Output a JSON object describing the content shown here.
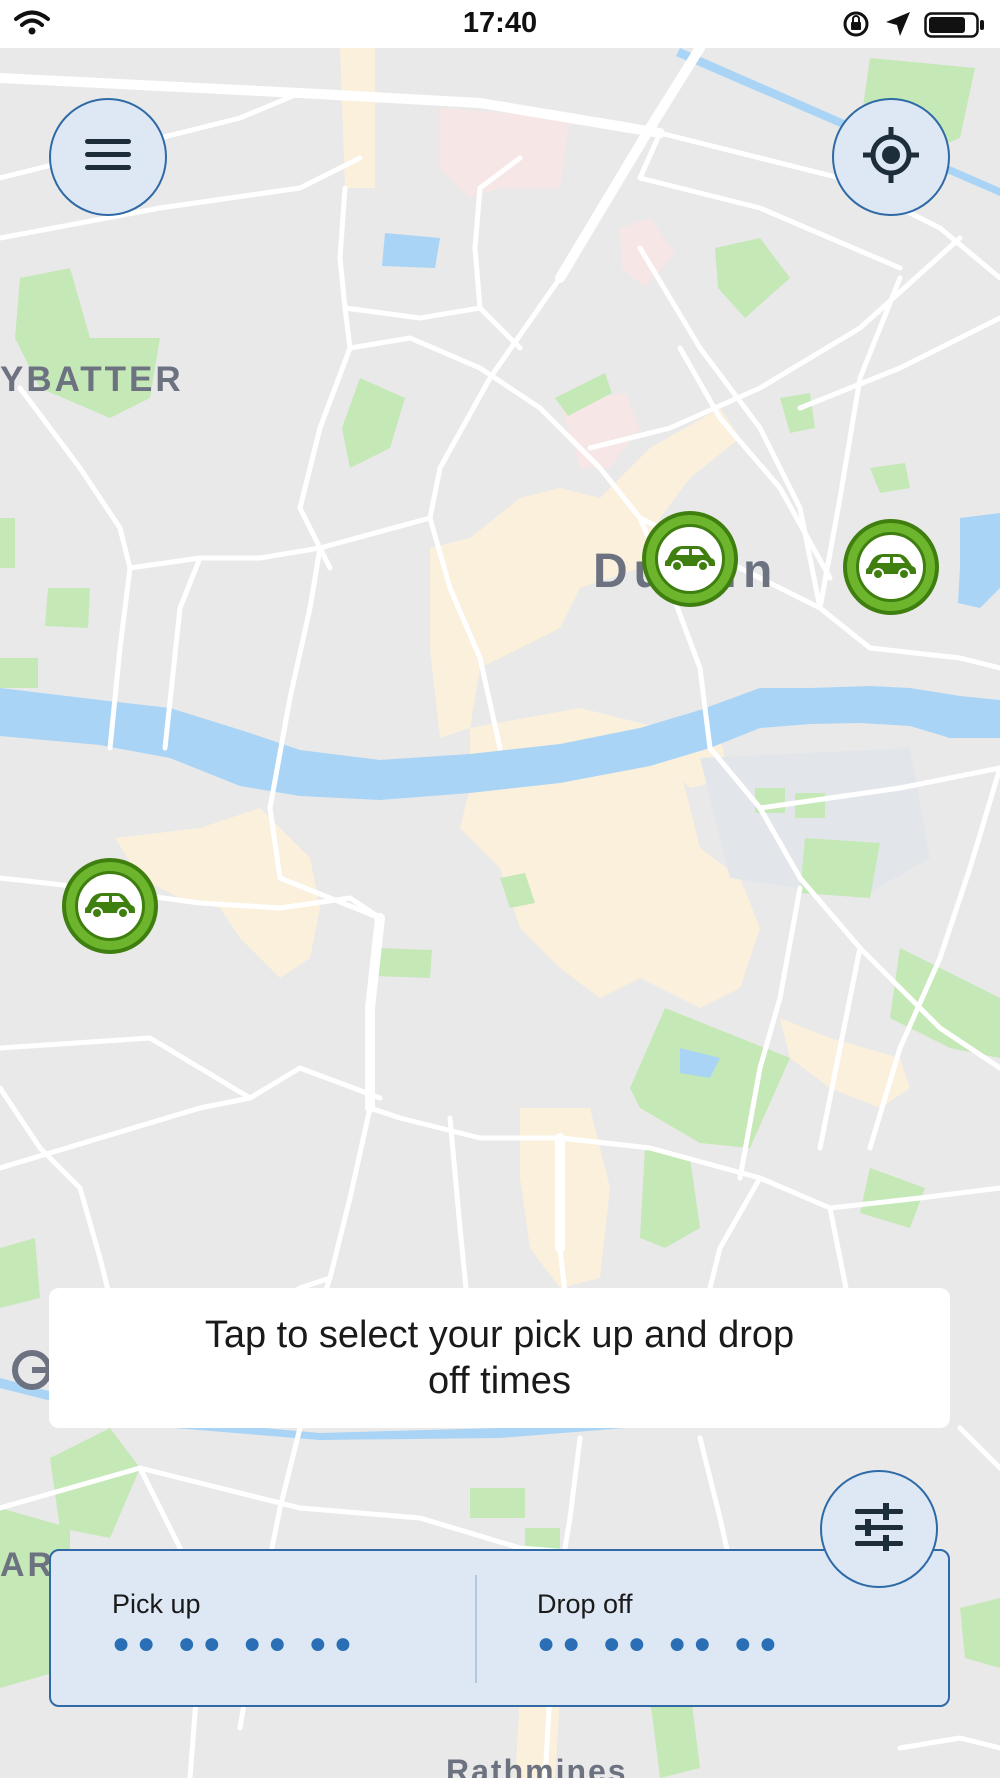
{
  "status_bar": {
    "time": "17:40",
    "icons": [
      "wifi-icon",
      "rotation-lock-icon",
      "location-arrow-icon",
      "battery-icon"
    ]
  },
  "map": {
    "labels": {
      "district_west": "YBATTER",
      "city": "Dublin",
      "district_south": "Rathmines",
      "edge_left": "AR"
    }
  },
  "controls": {
    "menu_icon": "hamburger-menu-icon",
    "locate_icon": "crosshair-location-icon",
    "filter_icon": "sliders-filter-icon"
  },
  "vehicles": [
    {
      "icon": "car-icon",
      "status": "available"
    },
    {
      "icon": "car-icon",
      "status": "available"
    },
    {
      "icon": "car-icon",
      "status": "available"
    }
  ],
  "hint": {
    "text": "Tap to select your pick up and drop off times"
  },
  "booking": {
    "pickup_label": "Pick up",
    "pickup_value": "●● ●● ●● ●●",
    "dropoff_label": "Drop off",
    "dropoff_value": "●● ●● ●● ●●"
  },
  "colors": {
    "accent_blue": "#2f6aa6",
    "button_fill": "#dde8f4",
    "car_green": "#6cb52d",
    "river": "#a9d4f5",
    "park": "#c5e8b7",
    "urban": "#fbf0dc",
    "map_bg": "#e9e9e9"
  }
}
